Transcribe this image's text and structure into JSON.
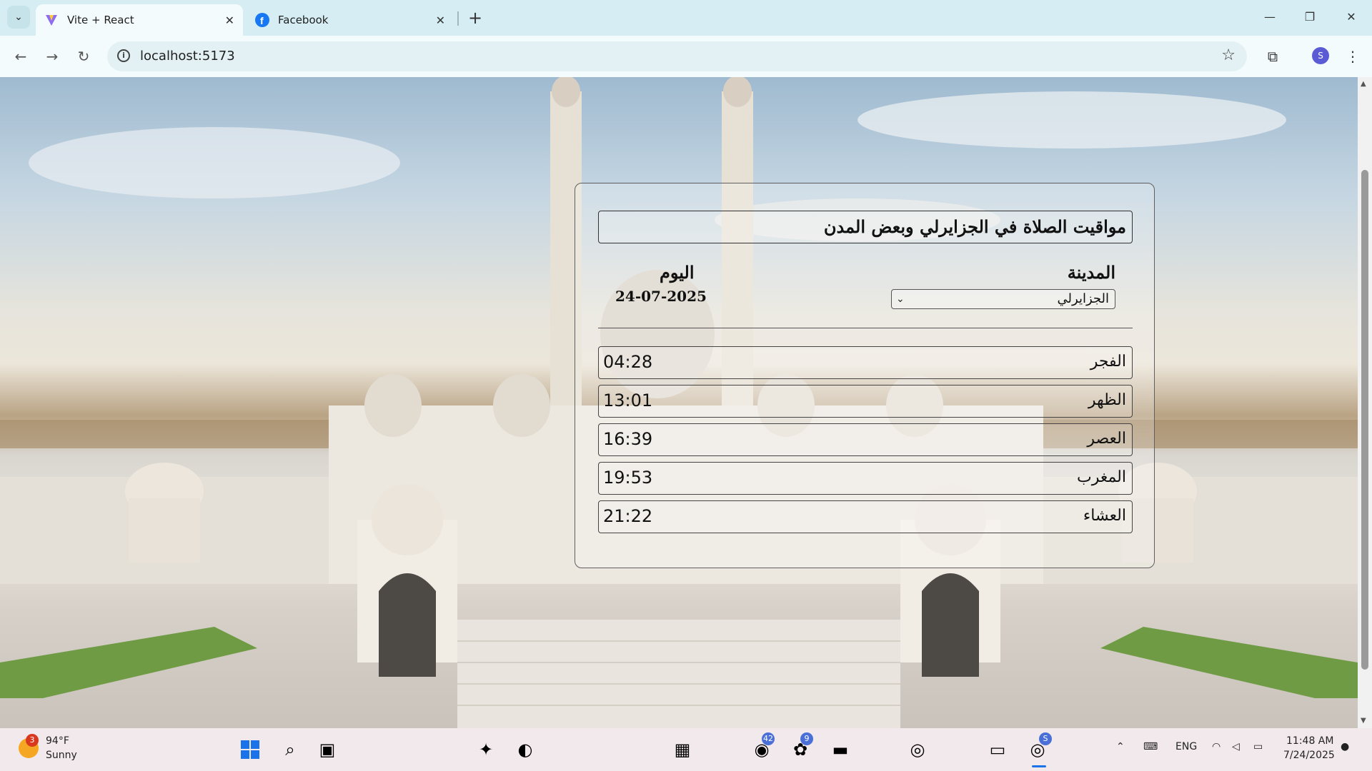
{
  "browser": {
    "tabs": [
      {
        "title": "Vite + React",
        "active": true,
        "icon": "vite-logo-icon"
      },
      {
        "title": "Facebook",
        "active": false,
        "icon": "facebook-icon"
      }
    ],
    "url": "localhost:5173",
    "profile_initial": "S"
  },
  "app": {
    "title": "مواقيت الصلاة في الجزايرلي وبعض المدن",
    "city_label": "المدينة",
    "city_selected": "الجزايرلي",
    "day_label": "اليوم",
    "date": "24-07-2025",
    "prayers": [
      {
        "name": "الفجر",
        "time": "04:28"
      },
      {
        "name": "الظهر",
        "time": "13:01"
      },
      {
        "name": "العصر",
        "time": "16:39"
      },
      {
        "name": "المغرب",
        "time": "19:53"
      },
      {
        "name": "العشاء",
        "time": "21:22"
      }
    ]
  },
  "taskbar": {
    "weather": {
      "temp": "94°F",
      "condition": "Sunny",
      "badge": "3"
    },
    "badges": {
      "whatsapp": "42",
      "chatgpt": "9",
      "chrome": "S"
    },
    "language": "ENG",
    "time": "11:48 AM",
    "date": "7/24/2025"
  }
}
